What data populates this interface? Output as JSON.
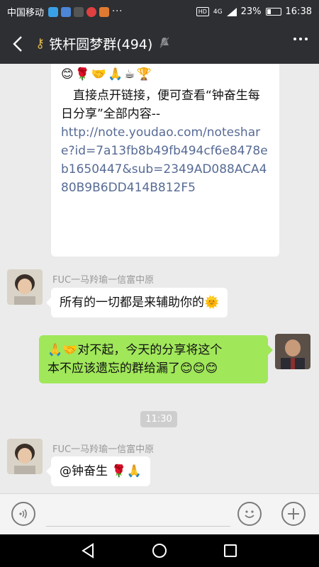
{
  "status_bar": {
    "carrier": "中国移动",
    "network": "4G",
    "hd": "HD",
    "battery": "23%",
    "time": "16:38"
  },
  "header": {
    "title": "铁杆圆梦群(494)"
  },
  "messages": {
    "m1": {
      "emojis": "😊🌹🤝🙏☕🏆",
      "text": "　直接点开链接，便可查看“钟奋生每日分享”全部内容--",
      "link": "http://note.youdao.com/noteshare?id=7a13fb8b49fb494cf6e8478eb1650447&sub=2349AD088ACA480B9B6DD414B812F5"
    },
    "m2": {
      "sender": "FUC一马羚瑜一信富中原",
      "text": "所有的一切都是来辅助你的🌞"
    },
    "m3": {
      "line1": "🙏🤝对不起，今天的分享将这个",
      "line2": "本不应该遗忘的群给漏了😊😊😊"
    },
    "time": "11:30",
    "m4": {
      "sender": "FUC一马羚瑜一信富中原",
      "text": "@钟奋生 🌹🙏"
    }
  },
  "colors": {
    "header_bg": "#2d2f33",
    "chat_bg": "#ebebeb",
    "self_bubble": "#a0e75a",
    "link": "#576b95"
  }
}
